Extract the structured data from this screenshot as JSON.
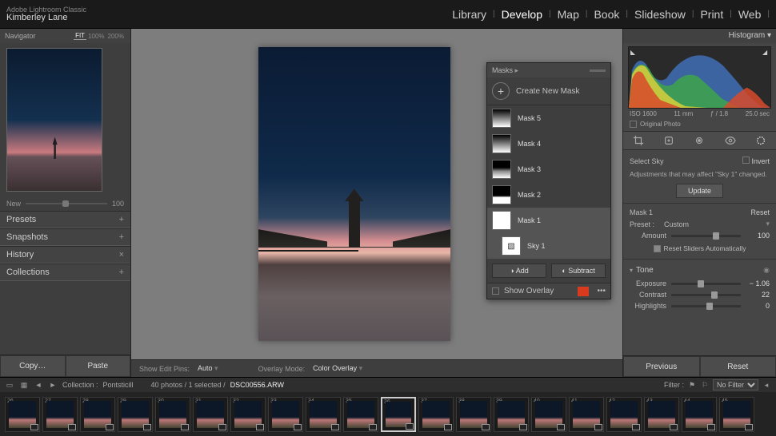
{
  "header": {
    "product": "Adobe Lightroom Classic",
    "identity": "Kimberley Lane",
    "modules": [
      "Library",
      "Develop",
      "Map",
      "Book",
      "Slideshow",
      "Print",
      "Web"
    ],
    "active_module": "Develop"
  },
  "left_panel": {
    "navigator": {
      "label": "Navigator",
      "zoom_modes": [
        "FIT",
        "100%",
        "200%"
      ],
      "active_zoom": "FIT"
    },
    "slider": {
      "label": "New",
      "value": "100"
    },
    "sections": [
      {
        "label": "Presets",
        "glyph": "+"
      },
      {
        "label": "Snapshots",
        "glyph": "+"
      },
      {
        "label": "History",
        "glyph": "×"
      },
      {
        "label": "Collections",
        "glyph": "+"
      }
    ],
    "buttons": {
      "copy": "Copy…",
      "paste": "Paste"
    }
  },
  "masks_panel": {
    "title": "Masks",
    "create": "Create New Mask",
    "items": [
      {
        "name": "Mask 5",
        "kind": "grad"
      },
      {
        "name": "Mask 4",
        "kind": "grad"
      },
      {
        "name": "Mask 3",
        "kind": "grad2"
      },
      {
        "name": "Mask 2",
        "kind": "grad3"
      },
      {
        "name": "Mask 1",
        "kind": "white",
        "selected": true
      },
      {
        "name": "Sky 1",
        "kind": "sky",
        "sub": true
      }
    ],
    "add": "Add",
    "subtract": "Subtract",
    "show_overlay": "Show Overlay",
    "overlay_color": "#d83a1e"
  },
  "center_footer": {
    "pins_label": "Show Edit Pins:",
    "pins_value": "Auto",
    "overlay_label": "Overlay Mode:",
    "overlay_value": "Color Overlay"
  },
  "right_panel": {
    "histogram_label": "Histogram ▾",
    "meta": {
      "iso": "ISO 1600",
      "focal": "11 mm",
      "aperture": "ƒ / 1.8",
      "shutter": "25.0 sec"
    },
    "original_photo": "Original Photo",
    "select_label": "Select Sky",
    "invert": "Invert",
    "message": "Adjustments that may affect \"Sky 1\" changed.",
    "update": "Update",
    "mask_name": "Mask 1",
    "reset": "Reset",
    "preset_label": "Preset :",
    "preset_value": "Custom",
    "amount": {
      "label": "Amount",
      "value": "100",
      "pos": 60
    },
    "reset_auto": "Reset Sliders Automatically",
    "tone_label": "Tone",
    "sliders": [
      {
        "label": "Exposure",
        "value": "− 1.06",
        "pos": 38
      },
      {
        "label": "Contrast",
        "value": "22",
        "pos": 58
      },
      {
        "label": "Highlights",
        "value": "0",
        "pos": 50
      }
    ],
    "buttons": {
      "previous": "Previous",
      "reset": "Reset"
    }
  },
  "filmstrip": {
    "collection_label": "Collection : ",
    "collection_name": "Pontsticill",
    "status": "40 photos / 1 selected /",
    "filename": "DSC00556.ARW",
    "filter_label": "Filter :",
    "filter_value": "No Filter",
    "selected_index": 10,
    "count": 20
  }
}
